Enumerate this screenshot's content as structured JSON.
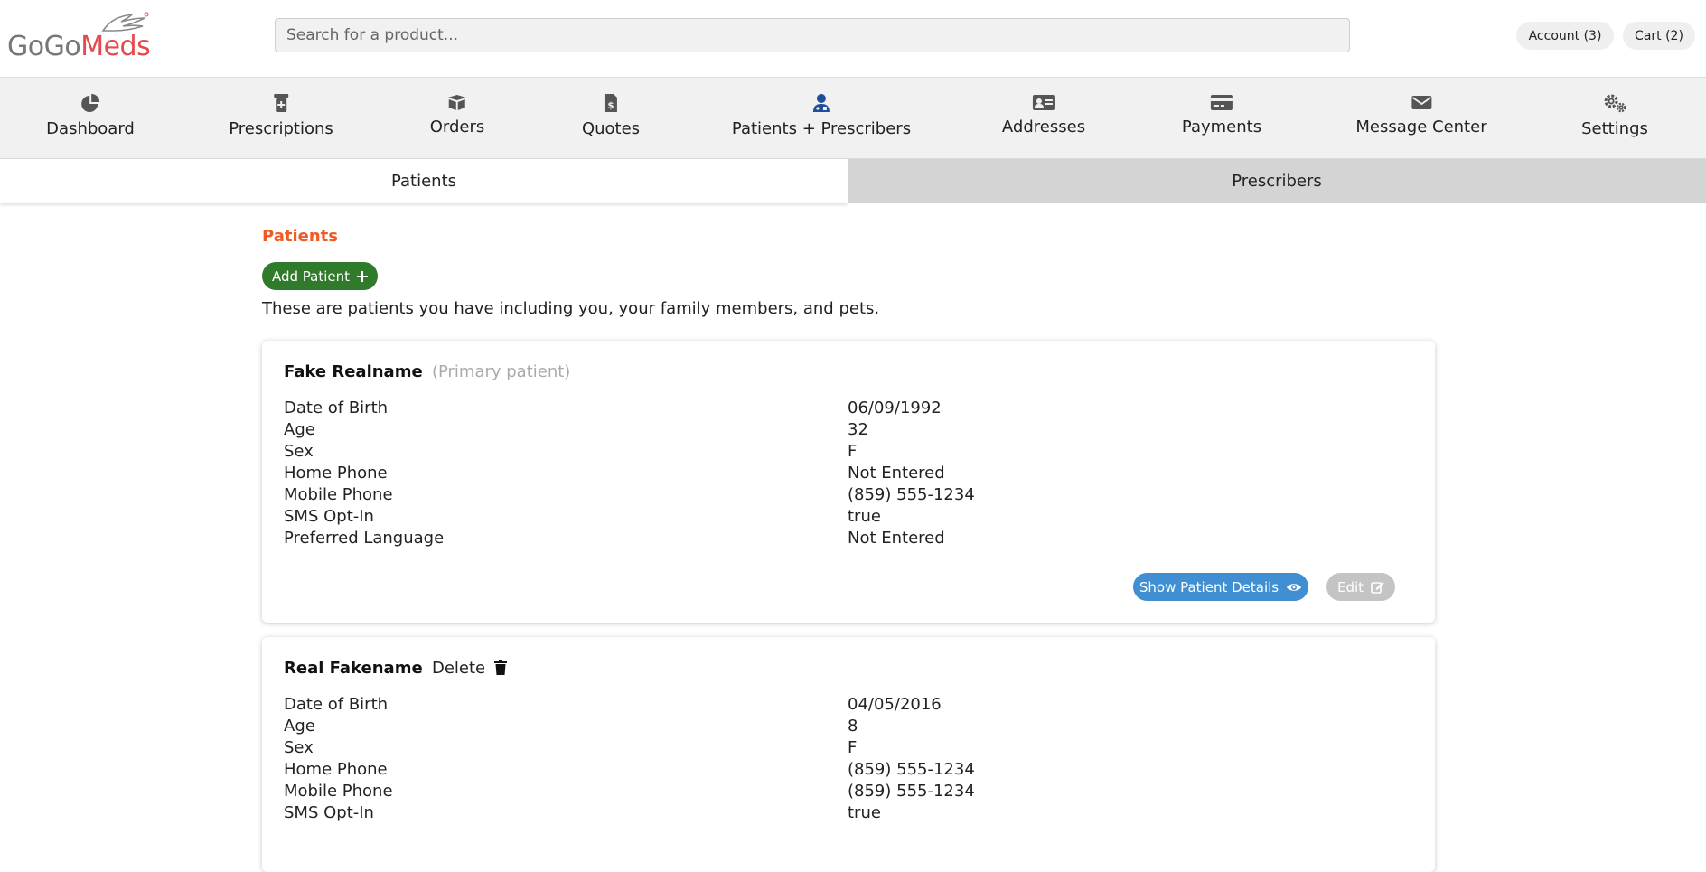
{
  "header": {
    "logo": {
      "part1": "GoGo",
      "part2": "Meds",
      "registered": "®"
    },
    "search": {
      "placeholder": "Search for a product..."
    },
    "account_label": "Account (3)",
    "cart_label": "Cart (2)"
  },
  "nav": {
    "items": [
      {
        "label": "Dashboard",
        "icon": "pie-chart-icon"
      },
      {
        "label": "Prescriptions",
        "icon": "prescription-bottle-icon"
      },
      {
        "label": "Orders",
        "icon": "box-icon"
      },
      {
        "label": "Quotes",
        "icon": "invoice-dollar-icon"
      },
      {
        "label": "Patients + Prescribers",
        "icon": "user-doctor-icon",
        "active": true
      },
      {
        "label": "Addresses",
        "icon": "address-card-icon"
      },
      {
        "label": "Payments",
        "icon": "credit-card-icon"
      },
      {
        "label": "Message Center",
        "icon": "envelope-icon"
      },
      {
        "label": "Settings",
        "icon": "gears-icon"
      }
    ]
  },
  "subtabs": {
    "patients": "Patients",
    "prescribers": "Prescribers",
    "active": "patients"
  },
  "content": {
    "title": "Patients",
    "add_patient_label": "Add Patient",
    "intro": "These are patients you have including you, your family members, and pets.",
    "patients": [
      {
        "name": "Fake Realname",
        "subtitle": "(Primary patient)",
        "fields": [
          {
            "label": "Date of Birth",
            "value": "06/09/1992"
          },
          {
            "label": "Age",
            "value": "32"
          },
          {
            "label": "Sex",
            "value": "F"
          },
          {
            "label": "Home Phone",
            "value": "Not Entered"
          },
          {
            "label": "Mobile Phone",
            "value": "(859) 555-1234"
          },
          {
            "label": "SMS Opt-In",
            "value": "true"
          },
          {
            "label": "Preferred Language",
            "value": "Not Entered"
          }
        ],
        "show_details_label": "Show Patient Details",
        "edit_label": "Edit"
      },
      {
        "name": "Real Fakename",
        "delete_label": "Delete",
        "fields": [
          {
            "label": "Date of Birth",
            "value": "04/05/2016"
          },
          {
            "label": "Age",
            "value": "8"
          },
          {
            "label": "Sex",
            "value": "F"
          },
          {
            "label": "Home Phone",
            "value": "(859) 555-1234"
          },
          {
            "label": "Mobile Phone",
            "value": "(859) 555-1234"
          },
          {
            "label": "SMS Opt-In",
            "value": "true"
          }
        ]
      }
    ]
  },
  "colors": {
    "accent_orange": "#f15a22",
    "add_green": "#2f7a2b",
    "details_blue": "#3f8fd2",
    "active_nav_icon": "#1f4f9a",
    "nav_icon": "#555555",
    "logo_red": "#e5484d"
  }
}
